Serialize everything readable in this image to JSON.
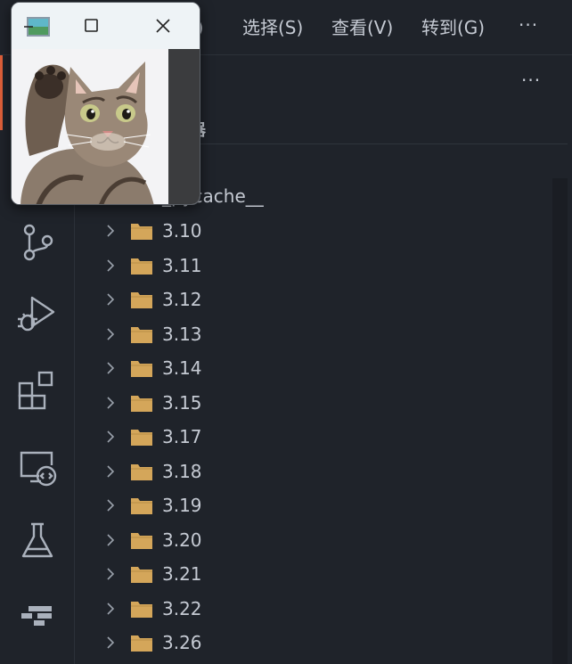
{
  "menu": {
    "items": [
      {
        "label": "E)"
      },
      {
        "label": "选择(S)"
      },
      {
        "label": "查看(V)"
      },
      {
        "label": "转到(G)"
      }
    ],
    "more": "···"
  },
  "sidebar": {
    "more": "···",
    "title": "器",
    "partial_item": "_pycache__",
    "folders": [
      {
        "label": "3.10"
      },
      {
        "label": "3.11"
      },
      {
        "label": "3.12"
      },
      {
        "label": "3.13"
      },
      {
        "label": "3.14"
      },
      {
        "label": "3.15"
      },
      {
        "label": "3.17"
      },
      {
        "label": "3.18"
      },
      {
        "label": "3.19"
      },
      {
        "label": "3.20"
      },
      {
        "label": "3.21"
      },
      {
        "label": "3.22"
      },
      {
        "label": "3.26"
      }
    ]
  },
  "activity_icons": [
    "source-control-icon",
    "run-debug-icon",
    "extensions-icon",
    "remote-explorer-icon",
    "testing-icon",
    "gitlens-icon"
  ],
  "colors": {
    "background": "#1f232a",
    "text": "#c5cad3",
    "folder": "#d4a65a",
    "accent": "#e0603a"
  }
}
